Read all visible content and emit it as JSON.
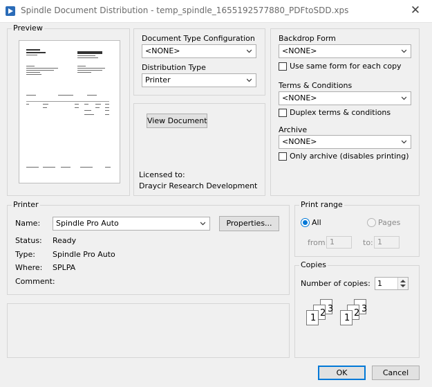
{
  "window": {
    "title": "Spindle Document Distribution - temp_spindle_1655192577880_PDFtoSDD.xps"
  },
  "preview": {
    "label": "Preview"
  },
  "doc_config": {
    "doc_type_label": "Document Type Configuration",
    "doc_type_value": "<NONE>",
    "dist_type_label": "Distribution Type",
    "dist_type_value": "Printer"
  },
  "view": {
    "button": "View Document",
    "licensed_to_label": "Licensed to:",
    "licensee": "Draycir Research  Development"
  },
  "backdrop": {
    "label": "Backdrop Form",
    "value": "<NONE>",
    "same_form_label": "Use same form for each copy"
  },
  "terms": {
    "label": "Terms & Conditions",
    "value": "<NONE>",
    "duplex_label": "Duplex terms & conditions"
  },
  "archive": {
    "label": "Archive",
    "value": "<NONE>",
    "only_label": "Only archive (disables printing)"
  },
  "printer": {
    "group_label": "Printer",
    "name_label": "Name:",
    "name_value": "Spindle Pro Auto",
    "properties_button": "Properties...",
    "status_label": "Status:",
    "status_value": "Ready",
    "type_label": "Type:",
    "type_value": "Spindle Pro Auto",
    "where_label": "Where:",
    "where_value": "SPLPA",
    "comment_label": "Comment:",
    "comment_value": ""
  },
  "print_range": {
    "group_label": "Print range",
    "all_label": "All",
    "pages_label": "Pages",
    "from_label": "from:",
    "from_value": "1",
    "to_label": "to:",
    "to_value": "1",
    "selected": "All"
  },
  "copies": {
    "group_label": "Copies",
    "number_label": "Number of copies:",
    "number_value": "1",
    "collate_digits": [
      "1",
      "2",
      "3"
    ]
  },
  "footer": {
    "ok": "OK",
    "cancel": "Cancel"
  },
  "colors": {
    "accent": "#0078d7",
    "app_icon": "#2b6cb8"
  },
  "icons": [
    "spindle-app-icon",
    "close-icon",
    "chevron-down-icon",
    "spin-up-icon",
    "spin-down-icon",
    "collate-pages-icon"
  ]
}
